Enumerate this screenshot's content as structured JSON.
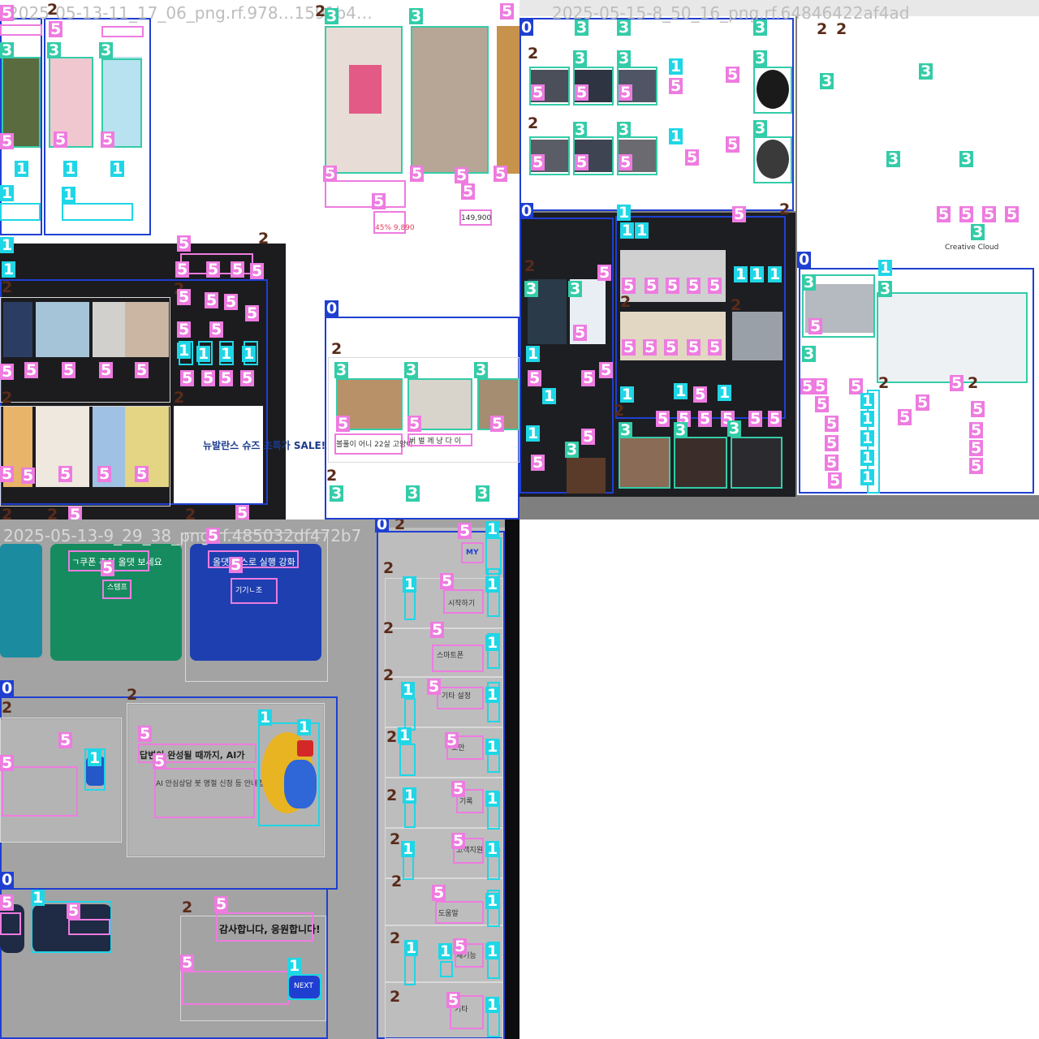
{
  "tiles": [
    {
      "filename": "2025-05-13-11_17_06_png.rf.978…1591b4…"
    },
    {
      "filename": "2025-05-15-8_50_16_png.rf.64846422af4ad"
    },
    {
      "filename": "2025-05-13-9_29_38_png.rf.485032df472b7"
    },
    {
      "filename": ""
    }
  ],
  "labels": {
    "c0": "0",
    "c1": "1",
    "c2": "2",
    "c3": "3",
    "c5": "5"
  },
  "texts": {
    "price_1": "45% 9,890",
    "price_2": "149,900",
    "sale_banner": "뉴발란스 슈즈 초특가 SALE!",
    "cat_caption_1": "볼풀이 어니 22살 고양이",
    "cat_caption_2": "버 벌 께 냥 다 이",
    "ad_title": "ㄱ쿠폰 추천 올댓 보세요",
    "ad_btn": "스탬프",
    "ad_title_2": "올댓 스스로 실행 강화",
    "ad_btn_2": "기기ㄴ조",
    "chat_title": "답변이 완성될 때까지, AI가",
    "chat_body": "AI 안심상담 봇 명절 신청 등 안내합니다",
    "next_btn": "NEXT",
    "thanks": "감사합니다, 응원합니다!",
    "mymenu": "MY",
    "menu_items": [
      "시작하기",
      "스마트폰",
      "기타 설정",
      "보안",
      "기록",
      "고객지원",
      "도움말",
      "새기능",
      "기타"
    ],
    "map_label": "Creative Cloud"
  },
  "colors": {
    "class0": "#1f3fd1",
    "class1": "#1fd6e6",
    "class2": "#5a2b1a",
    "class3": "#33cca8",
    "class5": "#ee7be0"
  }
}
